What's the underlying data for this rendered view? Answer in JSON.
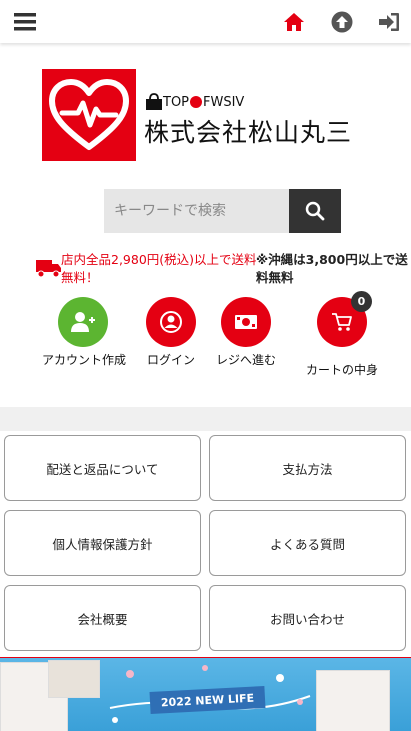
{
  "header": {
    "menu_icon": "hamburger-menu-icon",
    "home_icon": "home-icon",
    "upload_icon": "arrow-up-circle-icon",
    "login_icon": "sign-in-icon"
  },
  "logo": {
    "icon": "heart-pulse-icon",
    "brand": "TOP",
    "brand_suffix": "FWSIV",
    "company": "株式会社松山丸三"
  },
  "search": {
    "placeholder": "キーワードで検索",
    "button_icon": "search-icon"
  },
  "shipping": {
    "icon": "truck-icon",
    "red_text": "店内全品2,980円(税込)以上で送料無料！",
    "black_text": "※沖縄は3,800円以上で送料無料"
  },
  "quick_nav": [
    {
      "label": "アカウント作成",
      "icon": "add-user-icon",
      "color": "#5cb531"
    },
    {
      "label": "ログイン",
      "icon": "user-icon",
      "color": "#e40012"
    },
    {
      "label": "レジへ進む",
      "icon": "money-icon",
      "color": "#e40012"
    },
    {
      "label": "カートの中身",
      "icon": "cart-icon",
      "color": "#e40012"
    }
  ],
  "cart_count": "0",
  "links": [
    {
      "label": "配送と返品について"
    },
    {
      "label": "支払方法"
    },
    {
      "label": "個人情報保護方針"
    },
    {
      "label": "よくある質問"
    },
    {
      "label": "会社概要"
    },
    {
      "label": "お問い合わせ"
    }
  ],
  "banner": {
    "tag": "2022 NEW LIFE"
  },
  "colors": {
    "accent_red": "#e40012",
    "green": "#5cb531",
    "dark": "#333333"
  }
}
